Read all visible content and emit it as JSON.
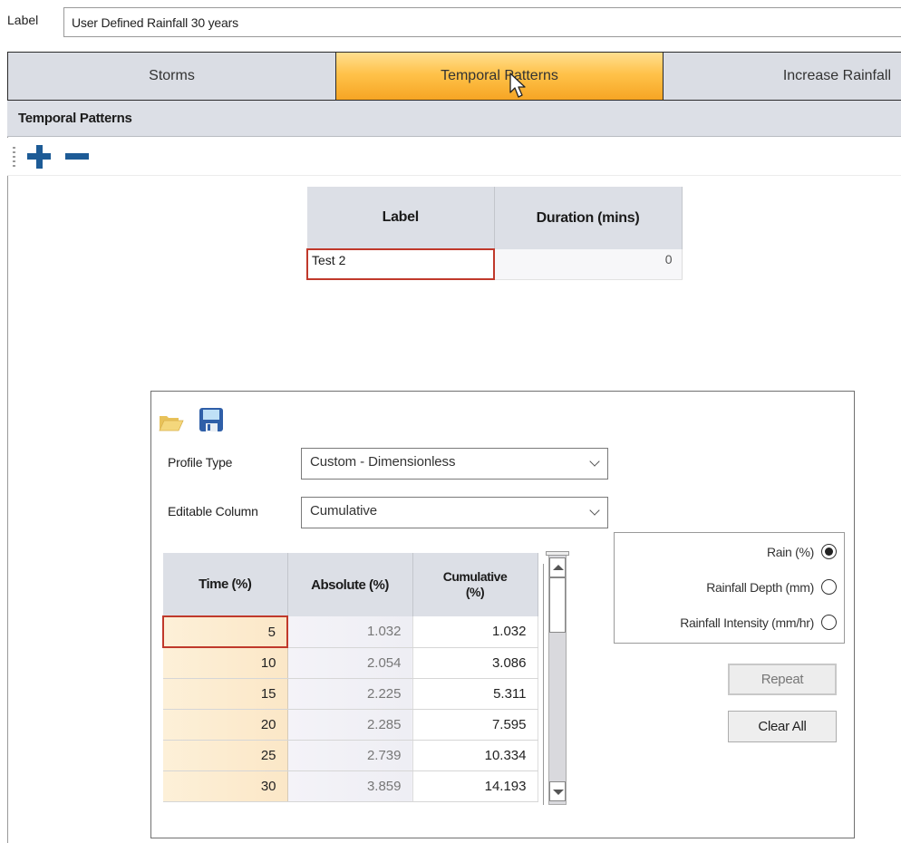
{
  "label_row": {
    "label": "Label",
    "value": "User Defined Rainfall 30 years"
  },
  "tabs": [
    {
      "label": "Storms",
      "active": false
    },
    {
      "label": "Temporal Patterns",
      "active": true
    },
    {
      "label": "Increase Rainfall",
      "active": false
    }
  ],
  "section": {
    "title": "Temporal Patterns"
  },
  "toolbar": {
    "add_icon": "plus-icon",
    "remove_icon": "minus-icon"
  },
  "patterns_table": {
    "columns": [
      "Label",
      "Duration (mins)"
    ],
    "rows": [
      {
        "label": "Test 2",
        "duration": "0"
      }
    ]
  },
  "panel": {
    "icons": [
      "folder-open-icon",
      "save-icon"
    ],
    "profile_type": {
      "label": "Profile Type",
      "value": "Custom - Dimensionless"
    },
    "editable_column": {
      "label": "Editable Column",
      "value": "Cumulative"
    },
    "grid": {
      "columns": [
        "Time (%)",
        "Absolute (%)",
        "Cumulative (%)"
      ],
      "rows": [
        {
          "time": "5",
          "absolute": "1.032",
          "cumulative": "1.032"
        },
        {
          "time": "10",
          "absolute": "2.054",
          "cumulative": "3.086"
        },
        {
          "time": "15",
          "absolute": "2.225",
          "cumulative": "5.311"
        },
        {
          "time": "20",
          "absolute": "2.285",
          "cumulative": "7.595"
        },
        {
          "time": "25",
          "absolute": "2.739",
          "cumulative": "10.334"
        },
        {
          "time": "30",
          "absolute": "3.859",
          "cumulative": "14.193"
        }
      ]
    },
    "units": {
      "options": [
        {
          "label": "Rain (%)",
          "selected": true
        },
        {
          "label": "Rainfall Depth (mm)",
          "selected": false
        },
        {
          "label": "Rainfall Intensity (mm/hr)",
          "selected": false
        }
      ]
    },
    "buttons": {
      "repeat": "Repeat",
      "clear_all": "Clear All"
    }
  },
  "colors": {
    "active_tab": "#ffc24a",
    "selection_border": "#c0392b",
    "toolbar_icon": "#1d5b96",
    "header_bg": "#dcdfe6"
  }
}
